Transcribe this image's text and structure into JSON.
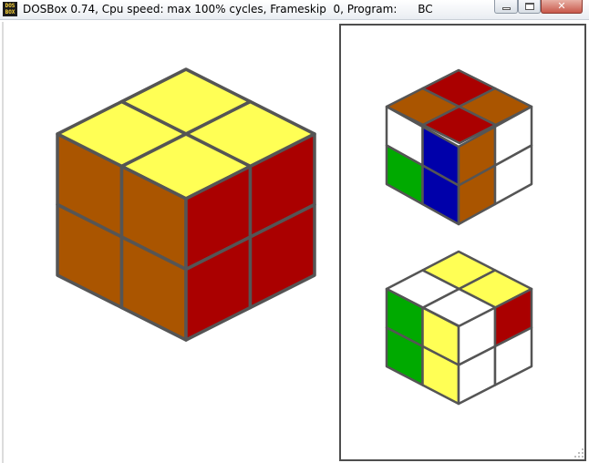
{
  "window": {
    "title": "DOSBox 0.74, Cpu speed: max 100% cycles, Frameskip  0, Program:      BC",
    "icon": "dosbox-icon",
    "icon_text": "DOS\nBOX",
    "controls": [
      "minimize-icon",
      "maximize-icon",
      "close-icon"
    ],
    "close_symbol": "✕"
  },
  "colors": {
    "yellow": "#ffff55",
    "orange": "#aa5500",
    "red": "#aa0000",
    "blue": "#0000aa",
    "green": "#00aa00",
    "white": "#ffffff",
    "grid": "#555555"
  },
  "cubes": {
    "main": {
      "top": [
        "yellow",
        "yellow",
        "yellow",
        "yellow"
      ],
      "left": [
        "orange",
        "orange",
        "orange",
        "orange"
      ],
      "right": [
        "red",
        "red",
        "red",
        "red"
      ]
    },
    "view_upper": {
      "top": [
        "red",
        "orange",
        "orange",
        "red"
      ],
      "left": [
        "white",
        "blue",
        "green",
        "blue"
      ],
      "right": [
        "orange",
        "white",
        "orange",
        "white"
      ]
    },
    "view_lower": {
      "top": [
        "yellow",
        "yellow",
        "white",
        "white"
      ],
      "left": [
        "green",
        "yellow",
        "green",
        "yellow"
      ],
      "right": [
        "white",
        "red",
        "white",
        "white"
      ]
    }
  }
}
